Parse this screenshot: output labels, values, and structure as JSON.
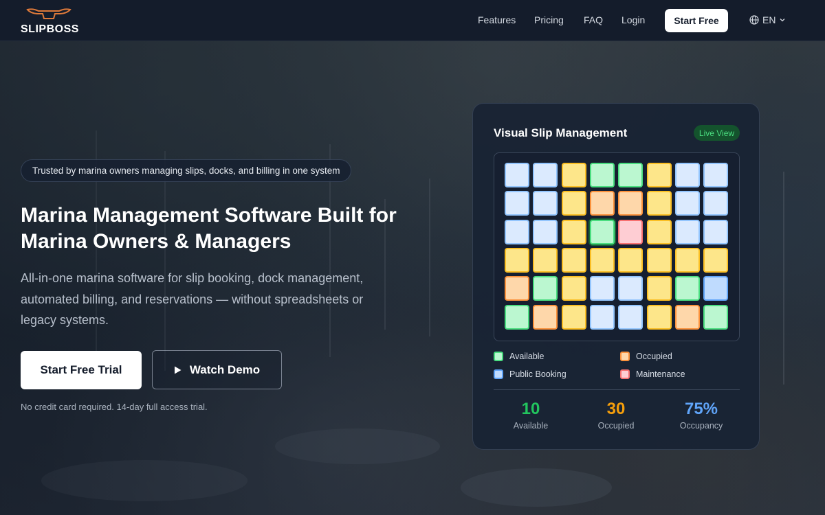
{
  "brand": {
    "name": "SLIPBOSS"
  },
  "nav": {
    "links": [
      "Features",
      "Pricing",
      "FAQ",
      "Login"
    ],
    "cta": "Start Free",
    "language": "EN"
  },
  "hero": {
    "trust": "Trusted by marina owners managing slips, docks, and billing in one system",
    "headline_line1": "Marina Management Software Built for",
    "headline_line2": "Marina Owners & Managers",
    "subtext": "All-in-one marina software for slip booking, dock management, automated billing, and reservations — without spreadsheets or legacy systems.",
    "primary_cta": "Start Free Trial",
    "secondary_cta": "Watch Demo",
    "disclaimer": "No credit card required. 14-day full access trial."
  },
  "panel": {
    "title": "Visual Slip Management",
    "badge": "Live View",
    "colors": {
      "available": "#4ade80",
      "occupied": "#fbbf24",
      "occupied_orange": "#fb923c",
      "public_booking": "#93c5fd",
      "maintenance": "#f87171"
    },
    "grid": [
      [
        "public",
        "public",
        "occupied",
        "available",
        "available",
        "occupied",
        "public",
        "public"
      ],
      [
        "public",
        "public",
        "occupied",
        "occupied-o",
        "occupied-o",
        "occupied",
        "public",
        "public"
      ],
      [
        "public",
        "public",
        "occupied",
        "available-selected",
        "maint",
        "occupied",
        "public",
        "public"
      ],
      [
        "occupied",
        "occupied",
        "occupied",
        "occupied",
        "occupied",
        "occupied",
        "occupied",
        "occupied"
      ],
      [
        "occupied-o",
        "available",
        "occupied",
        "public",
        "public",
        "occupied",
        "available",
        "public-strong"
      ],
      [
        "available",
        "occupied-o",
        "occupied",
        "public",
        "public",
        "occupied",
        "occupied-o",
        "available"
      ]
    ],
    "legend": {
      "available": "Available",
      "occupied": "Occupied",
      "public_booking": "Public Booking",
      "maintenance": "Maintenance"
    },
    "stats": [
      {
        "value": "10",
        "label": "Available",
        "color": "#22c55e"
      },
      {
        "value": "30",
        "label": "Occupied",
        "color": "#f59e0b"
      },
      {
        "value": "75%",
        "label": "Occupancy",
        "color": "#60a5fa"
      }
    ]
  }
}
